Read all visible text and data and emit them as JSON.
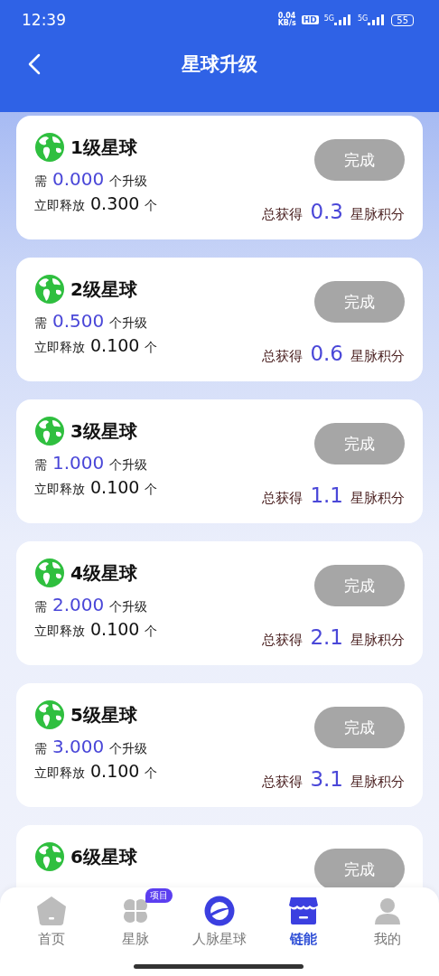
{
  "status_bar": {
    "time": "12:39",
    "net_speed": "0.04",
    "net_unit": "KB/s",
    "hd": "HD",
    "signals": [
      "5G",
      "5G"
    ],
    "battery": "55"
  },
  "header": {
    "title": "星球升级"
  },
  "cards": [
    {
      "title": "1级星球",
      "need_label": "需",
      "need_value": "0.000",
      "need_unit": "个升级",
      "release_label": "立即释放",
      "release_value": "0.300",
      "release_unit": "个",
      "total_label": "总获得",
      "total_value": "0.3",
      "total_unit": "星脉积分",
      "button": "完成",
      "disabled": true
    },
    {
      "title": "2级星球",
      "need_label": "需",
      "need_value": "0.500",
      "need_unit": "个升级",
      "release_label": "立即释放",
      "release_value": "0.100",
      "release_unit": "个",
      "total_label": "总获得",
      "total_value": "0.6",
      "total_unit": "星脉积分",
      "button": "完成",
      "disabled": true
    },
    {
      "title": "3级星球",
      "need_label": "需",
      "need_value": "1.000",
      "need_unit": "个升级",
      "release_label": "立即释放",
      "release_value": "0.100",
      "release_unit": "个",
      "total_label": "总获得",
      "total_value": "1.1",
      "total_unit": "星脉积分",
      "button": "完成",
      "disabled": true
    },
    {
      "title": "4级星球",
      "need_label": "需",
      "need_value": "2.000",
      "need_unit": "个升级",
      "release_label": "立即释放",
      "release_value": "0.100",
      "release_unit": "个",
      "total_label": "总获得",
      "total_value": "2.1",
      "total_unit": "星脉积分",
      "button": "完成",
      "disabled": true
    },
    {
      "title": "5级星球",
      "need_label": "需",
      "need_value": "3.000",
      "need_unit": "个升级",
      "release_label": "立即释放",
      "release_value": "0.100",
      "release_unit": "个",
      "total_label": "总获得",
      "total_value": "3.1",
      "total_unit": "星脉积分",
      "button": "完成",
      "disabled": true
    },
    {
      "title": "6级星球",
      "button": "完成",
      "disabled": true
    }
  ],
  "tab_bar": [
    {
      "kind": "home",
      "label": "首页",
      "selected": false
    },
    {
      "kind": "clover",
      "label": "星脉",
      "selected": false,
      "badge": "项目"
    },
    {
      "kind": "planet",
      "label": "人脉星球",
      "selected": false
    },
    {
      "kind": "shop",
      "label": "链能",
      "selected": true
    },
    {
      "kind": "profile",
      "label": "我的",
      "selected": false
    }
  ]
}
